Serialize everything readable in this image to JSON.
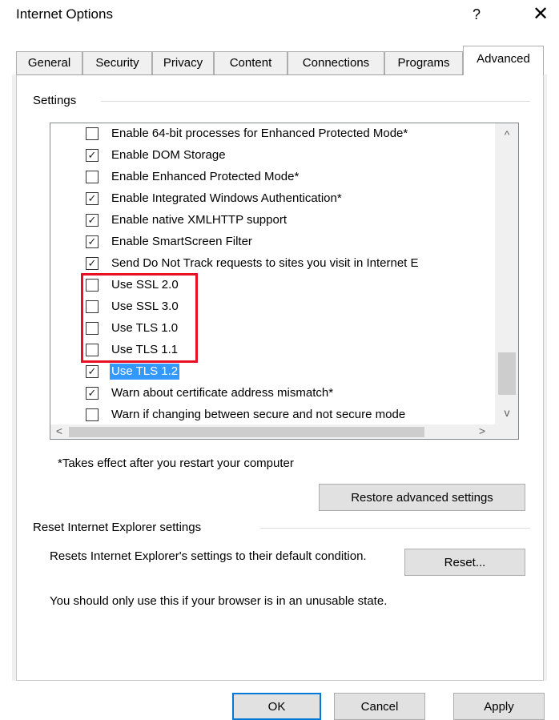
{
  "window": {
    "title": "Internet Options",
    "help_glyph": "?",
    "close_glyph": "✕"
  },
  "tabs": [
    {
      "label": "General"
    },
    {
      "label": "Security"
    },
    {
      "label": "Privacy"
    },
    {
      "label": "Content"
    },
    {
      "label": "Connections"
    },
    {
      "label": "Programs"
    },
    {
      "label": "Advanced",
      "active": true
    }
  ],
  "settings_group": {
    "label": "Settings",
    "items": [
      {
        "label": "Enable 64-bit processes for Enhanced Protected Mode*",
        "checked": false
      },
      {
        "label": "Enable DOM Storage",
        "checked": true
      },
      {
        "label": "Enable Enhanced Protected Mode*",
        "checked": false
      },
      {
        "label": "Enable Integrated Windows Authentication*",
        "checked": true
      },
      {
        "label": "Enable native XMLHTTP support",
        "checked": true
      },
      {
        "label": "Enable SmartScreen Filter",
        "checked": true
      },
      {
        "label": "Send Do Not Track requests to sites you visit in Internet E",
        "checked": true
      },
      {
        "label": "Use SSL 2.0",
        "checked": false
      },
      {
        "label": "Use SSL 3.0",
        "checked": false
      },
      {
        "label": "Use TLS 1.0",
        "checked": false
      },
      {
        "label": "Use TLS 1.1",
        "checked": false
      },
      {
        "label": "Use TLS 1.2",
        "checked": true,
        "selected": true
      },
      {
        "label": "Warn about certificate address mismatch*",
        "checked": true
      },
      {
        "label": "Warn if changing between secure and not secure mode",
        "checked": false
      }
    ],
    "scroll_up_glyph": "^",
    "scroll_down_glyph": "v",
    "scroll_left_glyph": "<",
    "scroll_right_glyph": ">",
    "restart_note": "*Takes effect after you restart your computer",
    "restore_button": "Restore advanced settings"
  },
  "reset_group": {
    "label": "Reset Internet Explorer settings",
    "description": "Resets Internet Explorer's settings to their default condition.",
    "reset_button": "Reset...",
    "warning": "You should only use this if your browser is in an unusable state."
  },
  "footer": {
    "ok_label": "OK",
    "cancel_label": "Cancel",
    "apply_label": "Apply"
  },
  "colors": {
    "selection": "#3399ff",
    "highlight_box": "#e81123",
    "default_button_border": "#0078d7"
  }
}
